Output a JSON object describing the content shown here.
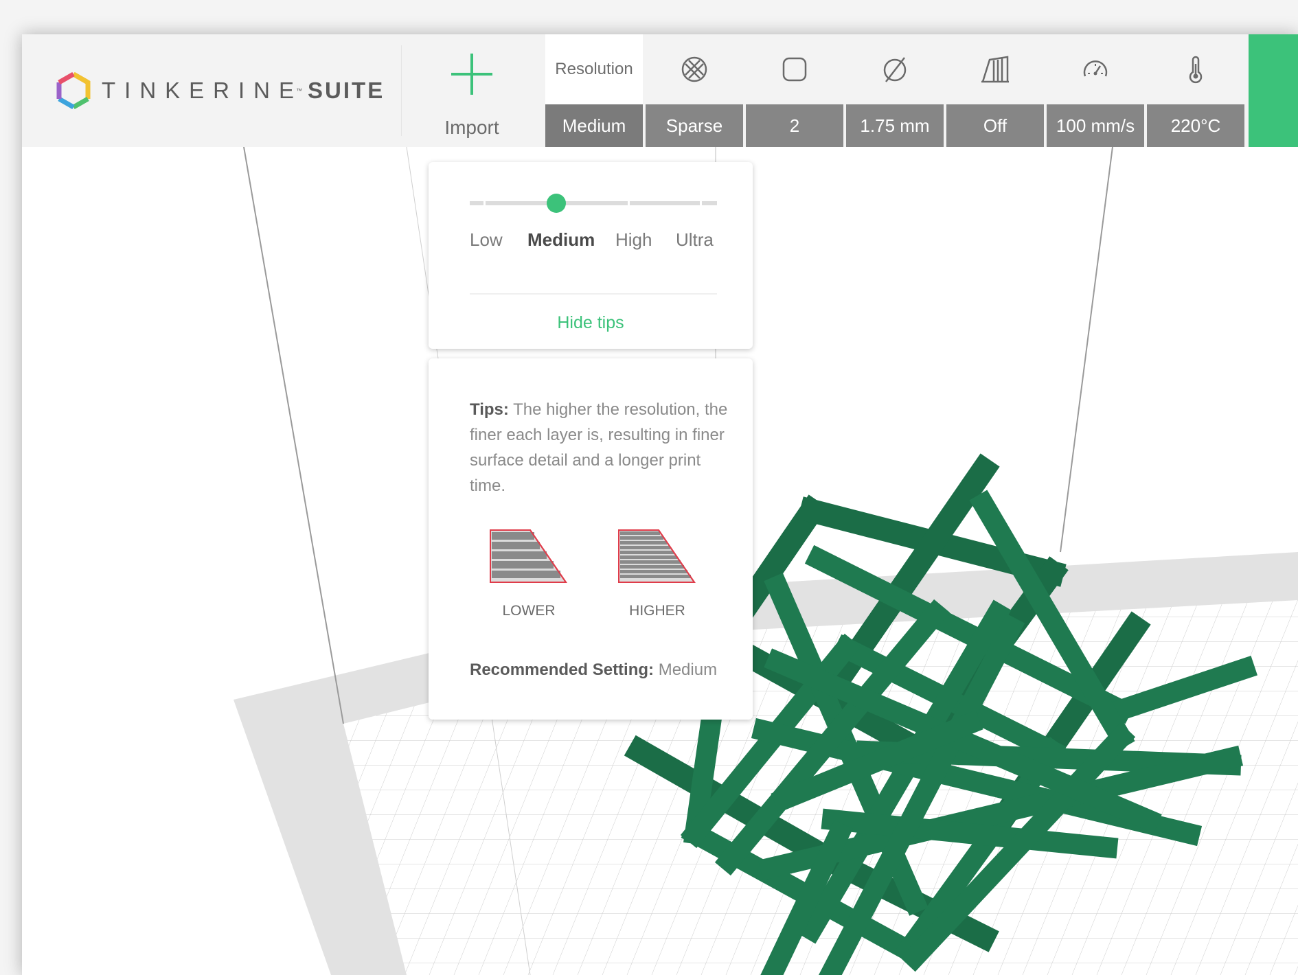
{
  "app": {
    "logo_word": "TINKERINE",
    "logo_tm": "™",
    "logo_suite": "SUITE"
  },
  "toolbar": {
    "import_label": "Import",
    "settings": [
      {
        "name": "resolution",
        "header": "Resolution",
        "icon": "resolution",
        "value": "Medium",
        "active": true
      },
      {
        "name": "infill",
        "header": "",
        "icon": "infill-pattern-icon",
        "value": "Sparse",
        "active": false
      },
      {
        "name": "shells",
        "header": "",
        "icon": "shell-square-icon",
        "value": "2",
        "active": false
      },
      {
        "name": "filament-diameter",
        "header": "",
        "icon": "diameter-icon",
        "value": "1.75 mm",
        "active": false
      },
      {
        "name": "supports",
        "header": "",
        "icon": "support-columns-icon",
        "value": "Off",
        "active": false
      },
      {
        "name": "speed",
        "header": "",
        "icon": "speedometer-icon",
        "value": "100 mm/s",
        "active": false
      },
      {
        "name": "temperature",
        "header": "",
        "icon": "thermometer-icon",
        "value": "220°C",
        "active": false
      }
    ]
  },
  "resolution_panel": {
    "levels": [
      "Low",
      "Medium",
      "High",
      "Ultra"
    ],
    "selected": "Medium",
    "hide_tips": "Hide tips"
  },
  "tips": {
    "label": "Tips:",
    "text": "The higher the resolution, the finer each layer is, resulting in finer surface detail and a longer print time.",
    "lower_caption": "LOWER",
    "higher_caption": "HIGHER",
    "recommended_label": "Recommended Setting:",
    "recommended_value": "Medium"
  },
  "colors": {
    "accent": "#3cc27a",
    "model": "#1f7a50",
    "toolbar_bg": "#f3f3f3",
    "value_bg": "#868686"
  }
}
